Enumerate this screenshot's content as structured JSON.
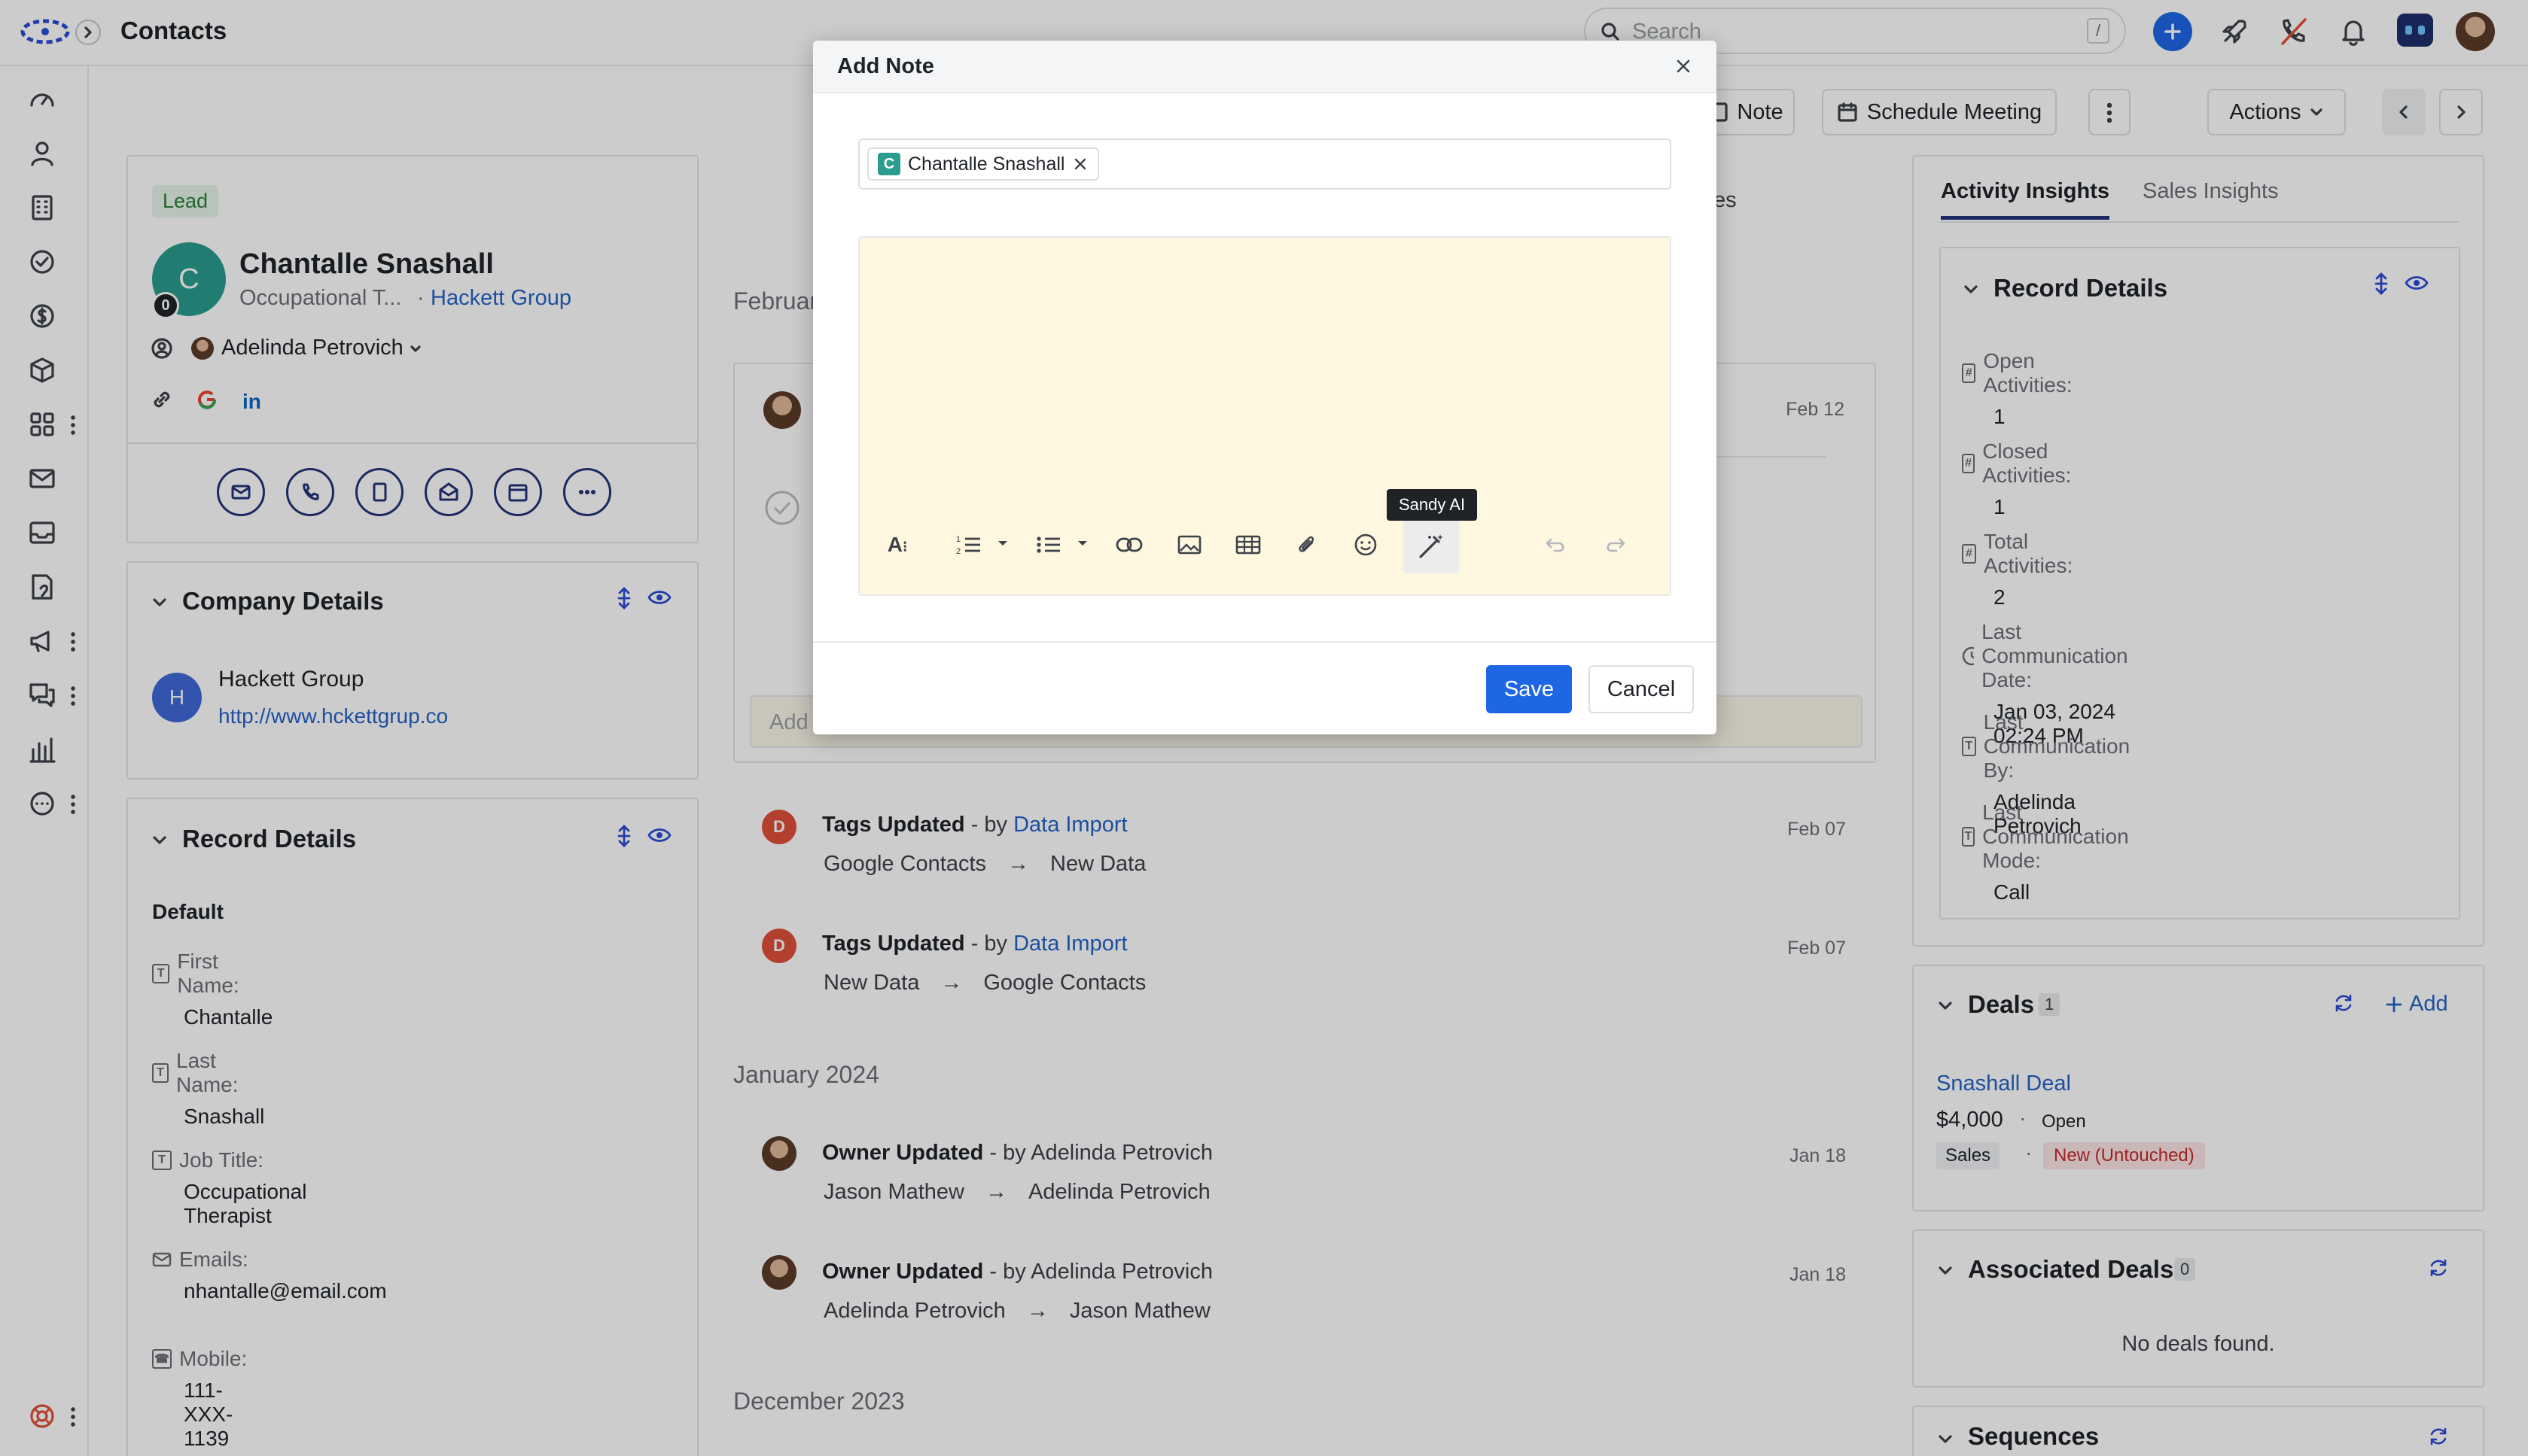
{
  "app": {
    "title": "Contacts"
  },
  "topbar": {
    "search_placeholder": "Search",
    "search_shortcut": "/"
  },
  "toolbar": {
    "note_label": "Note",
    "schedule_label": "Schedule Meeting",
    "actions_label": "Actions"
  },
  "contact": {
    "badge": "Lead",
    "initial": "C",
    "count": "0",
    "name": "Chantalle Snashall",
    "title_trunc": "Occupational T...",
    "company_sep": "·",
    "company": "Hackett Group",
    "owner": "Adelinda Petrovich"
  },
  "company_details": {
    "title": "Company Details",
    "initial": "H",
    "name": "Hackett Group",
    "url": "http://www.hckettgrup.co"
  },
  "record_details_left": {
    "title": "Record Details",
    "group": "Default",
    "fields": [
      {
        "label": "First Name:",
        "value": "Chantalle"
      },
      {
        "label": "Last Name:",
        "value": "Snashall"
      },
      {
        "label": "Job Title:",
        "value": "Occupational Therapist"
      },
      {
        "label": "Emails:",
        "value": "nhantalle@email.com"
      },
      {
        "label": "Mobile:",
        "value": "111-XXX-1139"
      }
    ]
  },
  "feed": {
    "month_feb": "Februar",
    "pinned_date": "Feb 12",
    "add_placeholder": "Add",
    "items": [
      {
        "initial": "D",
        "action": "Tags Updated",
        "by": "- by",
        "actor": "Data Import",
        "date": "Feb 07",
        "from": "Google Contacts",
        "to": "New Data"
      },
      {
        "initial": "D",
        "action": "Tags Updated",
        "by": "- by",
        "actor": "Data Import",
        "date": "Feb 07",
        "from": "New Data",
        "to": "Google Contacts"
      }
    ],
    "month_jan": "January 2024",
    "jan_items": [
      {
        "action": "Owner Updated",
        "by": "- by Adelinda Petrovich",
        "date": "Jan 18",
        "from": "Jason Mathew",
        "to": "Adelinda Petrovich"
      },
      {
        "action": "Owner Updated",
        "by": "- by Adelinda Petrovich",
        "date": "Jan 18",
        "from": "Adelinda Petrovich",
        "to": "Jason Mathew"
      }
    ],
    "month_dec": "December 2023",
    "tab_fragment": "tes",
    "arrow": "→"
  },
  "right_panel": {
    "tabs": [
      "Activity Insights",
      "Sales Insights"
    ],
    "record_title": "Record Details",
    "fields": [
      {
        "label": "Open Activities:",
        "value": "1",
        "icon": "#"
      },
      {
        "label": "Closed Activities:",
        "value": "1",
        "icon": "#"
      },
      {
        "label": "Total Activities:",
        "value": "2",
        "icon": "#"
      },
      {
        "label": "Last Communication Date:",
        "value": "Jan 03, 2024 02:24 PM",
        "icon": "clock"
      },
      {
        "label": "Last Communication By:",
        "value": "Adelinda Petrovich",
        "icon": "T"
      },
      {
        "label": "Last Communication Mode:",
        "value": "Call",
        "icon": "T"
      }
    ],
    "deals": {
      "title": "Deals",
      "count": "1",
      "add": "Add",
      "deal_name": "Snashall Deal",
      "amount": "$4,000",
      "status": "Open",
      "pipeline": "Sales",
      "stage": "New (Untouched)"
    },
    "assoc": {
      "title": "Associated Deals",
      "count": "0",
      "empty": "No deals found."
    },
    "sequences": {
      "title": "Sequences"
    }
  },
  "modal": {
    "title": "Add Note",
    "recipient_initial": "C",
    "recipient": "Chantalle Snashall",
    "tooltip": "Sandy AI",
    "save": "Save",
    "cancel": "Cancel",
    "editor_bg": "#fff7e0"
  },
  "colors": {
    "accent": "#1f66e5",
    "avatar_teal": "#2a9d8f",
    "navy": "#23327a",
    "lead_bg": "#e6f4ea",
    "lead_fg": "#2e7d32"
  }
}
